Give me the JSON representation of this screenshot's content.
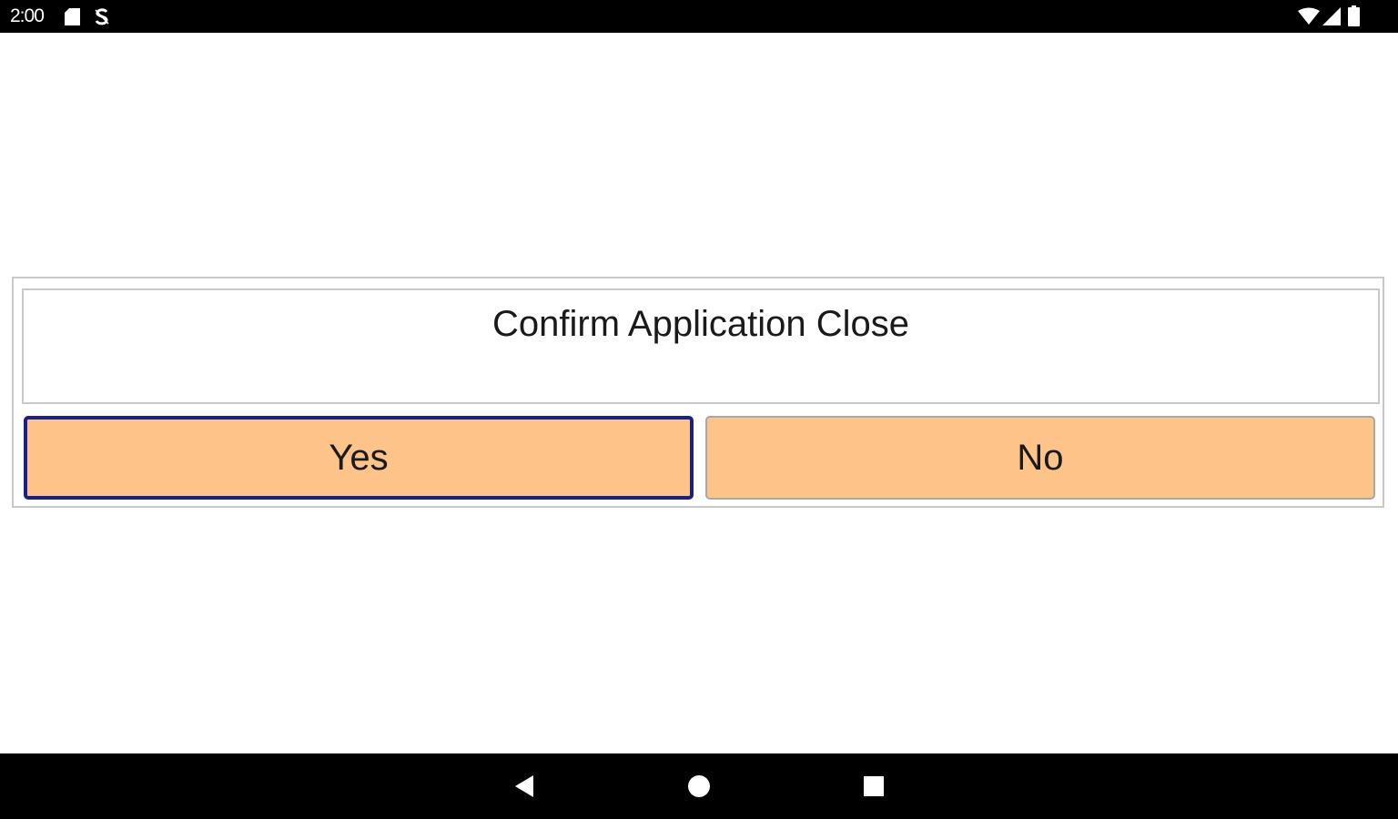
{
  "status_bar": {
    "time": "2:00",
    "icons": [
      "sd-card-icon",
      "sync-s-icon",
      "wifi-icon",
      "cell-signal-icon",
      "battery-icon"
    ]
  },
  "dialog": {
    "title": "Confirm Application Close",
    "yes_label": "Yes",
    "no_label": "No"
  },
  "colors": {
    "button_fill": "#fec388",
    "focused_border": "#1b1f86",
    "frame_border": "#c9c9c9"
  },
  "nav_bar": {
    "buttons": [
      "back-icon",
      "home-icon",
      "recents-icon"
    ]
  }
}
